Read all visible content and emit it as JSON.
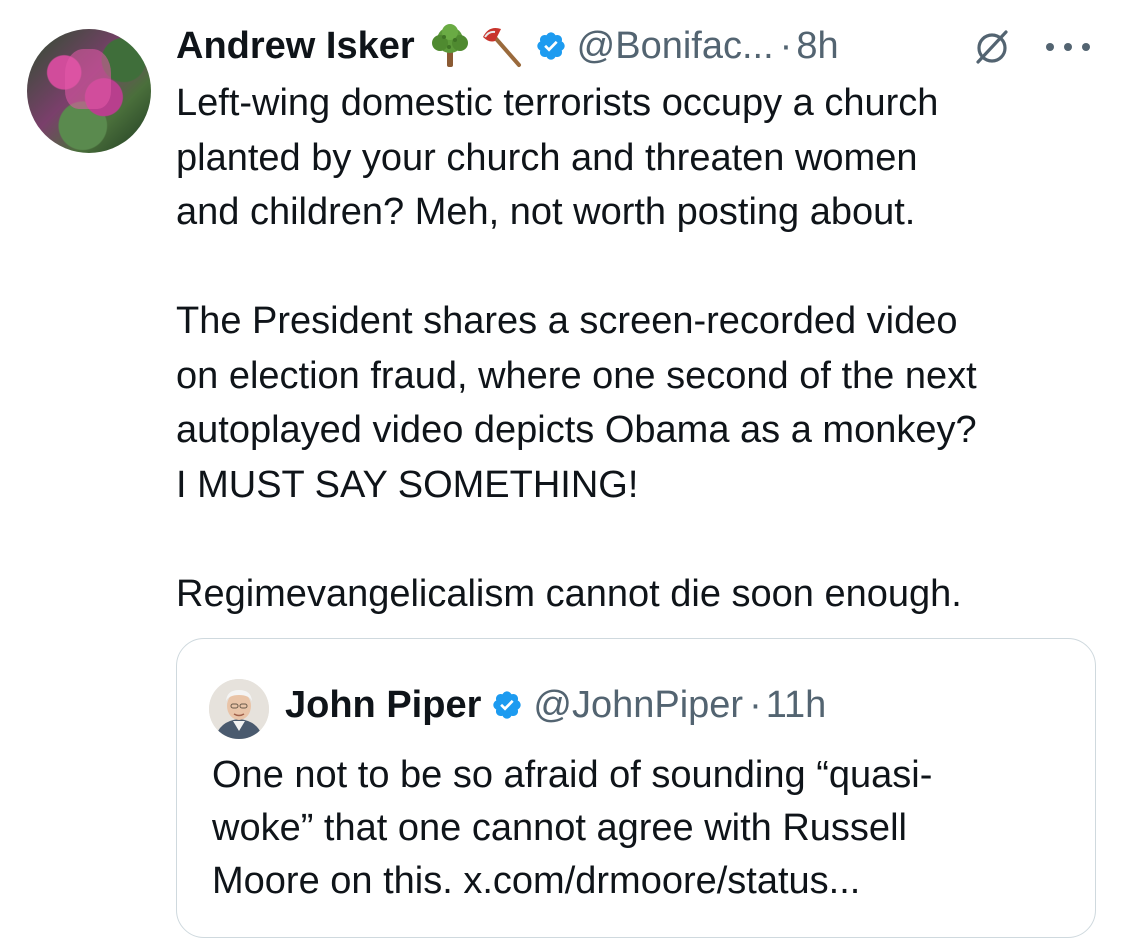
{
  "tweet": {
    "author_name": "Andrew Isker",
    "emoji_icons": [
      "tree-emoji-icon",
      "axe-emoji-icon"
    ],
    "handle": "@Bonifac...",
    "separator": "·",
    "time": "8h",
    "body_paragraphs": [
      "Left-wing domestic terrorists occupy a church\nplanted by your church and threaten women\nand children? Meh, not worth posting about.",
      "The President shares a screen-recorded video\non election fraud, where one second of the next\nautoplayed video depicts Obama as a monkey?\nI MUST SAY SOMETHING!",
      "Regimevangelicalism cannot die soon enough."
    ]
  },
  "quoted_tweet": {
    "author_name": "John Piper",
    "handle": "@JohnPiper",
    "separator": "·",
    "time": "11h",
    "body": "One not to be so afraid of sounding “quasi-\nwoke” that one cannot agree with Russell\nMoore on this. x.com/drmoore/status..."
  },
  "colors": {
    "text": "#0f1419",
    "secondary": "#536471",
    "verified": "#1d9bf0",
    "border": "#cfd9de"
  },
  "icons": {
    "verified": "verified-badge-icon",
    "grok": "grok-icon",
    "more": "more-options-icon"
  }
}
